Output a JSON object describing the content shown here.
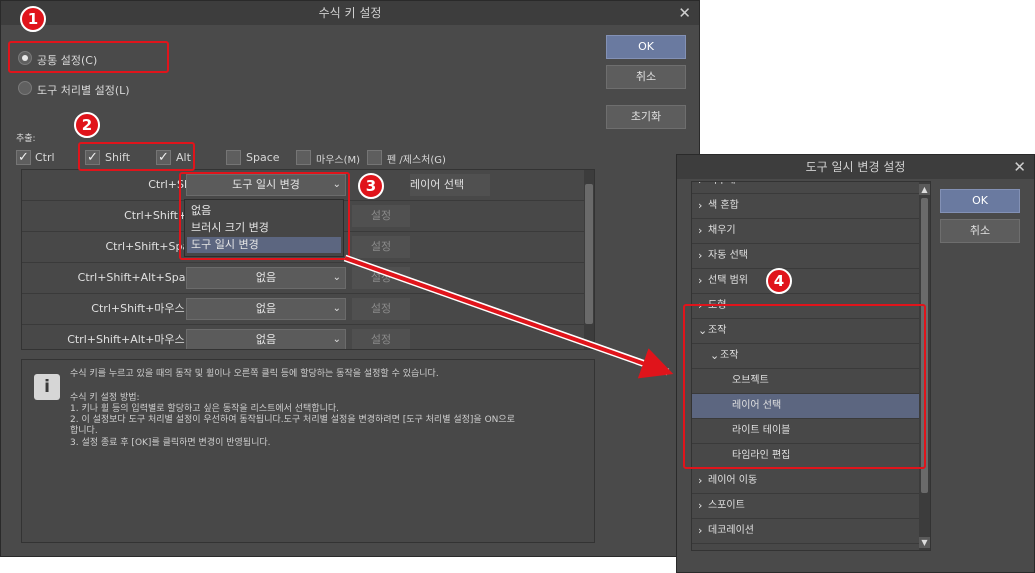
{
  "main_dialog": {
    "title": "수식 키 설정",
    "radio_common": "공통 설정(C)",
    "radio_tool": "도구 처리별 설정(L)",
    "ok": "OK",
    "cancel": "취소",
    "reset": "초기화",
    "add_label": "추출:",
    "checkboxes": [
      {
        "label": "Ctrl",
        "checked": true
      },
      {
        "label": "Shift",
        "checked": true
      },
      {
        "label": "Alt",
        "checked": true
      },
      {
        "label": "Space",
        "checked": false
      },
      {
        "label": "마우스(M)",
        "checked": false
      },
      {
        "label": "펜 /제스처(G)",
        "checked": false
      }
    ],
    "rows": [
      {
        "key": "Ctrl+Shift",
        "action": "도구 일시 변경",
        "setting": "레이어 선택"
      },
      {
        "key": "Ctrl+Shift+Alt",
        "action": "",
        "setting": "설정"
      },
      {
        "key": "Ctrl+Shift+Space",
        "action": "",
        "setting": "설정"
      },
      {
        "key": "Ctrl+Shift+Alt+Space:",
        "action": "없음",
        "setting": "설정"
      },
      {
        "key": "Ctrl+Shift+마우스 휠:",
        "action": "없음",
        "setting": "설정"
      },
      {
        "key": "Ctrl+Shift+Alt+마우스 휠:",
        "action": "없음",
        "setting": "설정"
      }
    ],
    "dropdown_options": [
      "없음",
      "브러시 크기 변경",
      "도구 일시 변경"
    ],
    "info": {
      "line1": "수식 키를 누르고 있을 때의 동작 및 휠이나 오른쪽 클릭 등에 할당하는 동작을 설정할 수 있습니다.",
      "line2": "수식 키 설정 방법:",
      "line3": "1. 키나 휠 등의 입력별로 할당하고 싶은 동작을 리스트에서 선택합니다.",
      "line4": "2. 이 설정보다 도구 처리별 설정이 우선하여 동작됩니다.도구 처리별 설정을 변경하려면 [도구 처리별 설정]을 ON으로",
      "line5": "합니다.",
      "line6": "3. 설정 종료 후 [OK]를 클릭하면 변경이 반영됩니다."
    }
  },
  "tool_dialog": {
    "title": "도구 일시 변경 설정",
    "ok": "OK",
    "cancel": "취소",
    "items": [
      {
        "label": "지우개",
        "arrow": "›"
      },
      {
        "label": "색 혼합",
        "arrow": "›"
      },
      {
        "label": "채우기",
        "arrow": "›"
      },
      {
        "label": "자동 선택",
        "arrow": "›"
      },
      {
        "label": "선택 범위",
        "arrow": "›"
      },
      {
        "label": "도형",
        "arrow": "›"
      },
      {
        "label": "조작",
        "arrow": "⌄"
      },
      {
        "label": "조작",
        "arrow": "⌄"
      },
      {
        "label": "오브젝트",
        "arrow": ""
      },
      {
        "label": "레이어 선택",
        "arrow": ""
      },
      {
        "label": "라이트 테이블",
        "arrow": ""
      },
      {
        "label": "타임라인 편집",
        "arrow": ""
      },
      {
        "label": "레이어 이동",
        "arrow": "›"
      },
      {
        "label": "스포이트",
        "arrow": "›"
      },
      {
        "label": "데코레이션",
        "arrow": "›"
      }
    ]
  },
  "badges": [
    "1",
    "2",
    "3",
    "4"
  ],
  "colors": {
    "annotation_red": "#e0141b",
    "selection": "#5c6680",
    "ok_button": "#6a7aa0"
  }
}
